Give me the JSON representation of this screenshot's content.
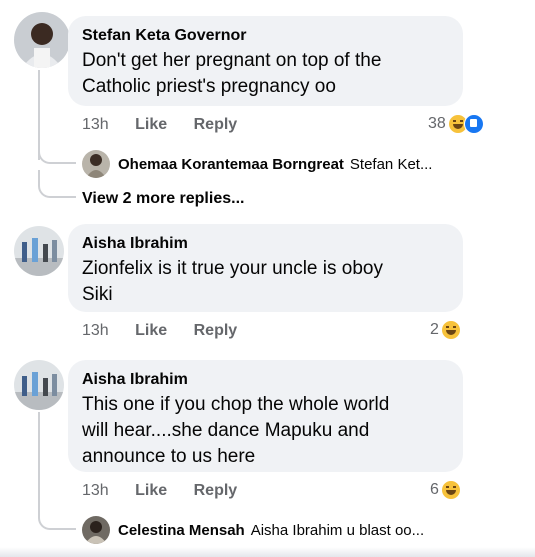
{
  "comments": [
    {
      "author": "Stefan Keta Governor",
      "text_lines": [
        "Don't get her pregnant on top of the",
        "Catholic priest's pregnancy oo"
      ],
      "time": "13h",
      "like_label": "Like",
      "reply_label": "Reply",
      "reaction_count": "38",
      "reply_preview": {
        "name": "Ohemaa Korantemaa Borngreat",
        "text": "Stefan Ket..."
      },
      "view_more": "View 2 more replies..."
    },
    {
      "author": "Aisha Ibrahim",
      "text_lines": [
        "Zionfelix is it true your uncle is oboy",
        "Siki"
      ],
      "time": "13h",
      "like_label": "Like",
      "reply_label": "Reply",
      "reaction_count": "2"
    },
    {
      "author": "Aisha Ibrahim",
      "text_lines": [
        "This one if you chop the whole world",
        "will hear....she dance Mapuku and",
        "announce to us here"
      ],
      "time": "13h",
      "like_label": "Like",
      "reply_label": "Reply",
      "reaction_count": "6",
      "reply_preview": {
        "name": "Celestina Mensah",
        "text": "Aisha Ibrahim u blast oo..."
      }
    }
  ],
  "icons": {
    "haha": "haha-emoji-icon",
    "like": "like-reaction-icon"
  },
  "colors": {
    "bubble": "#f0f2f5",
    "meta": "#65676b",
    "like_blue": "#1877f2",
    "haha_yellow": "#f7c23b"
  }
}
